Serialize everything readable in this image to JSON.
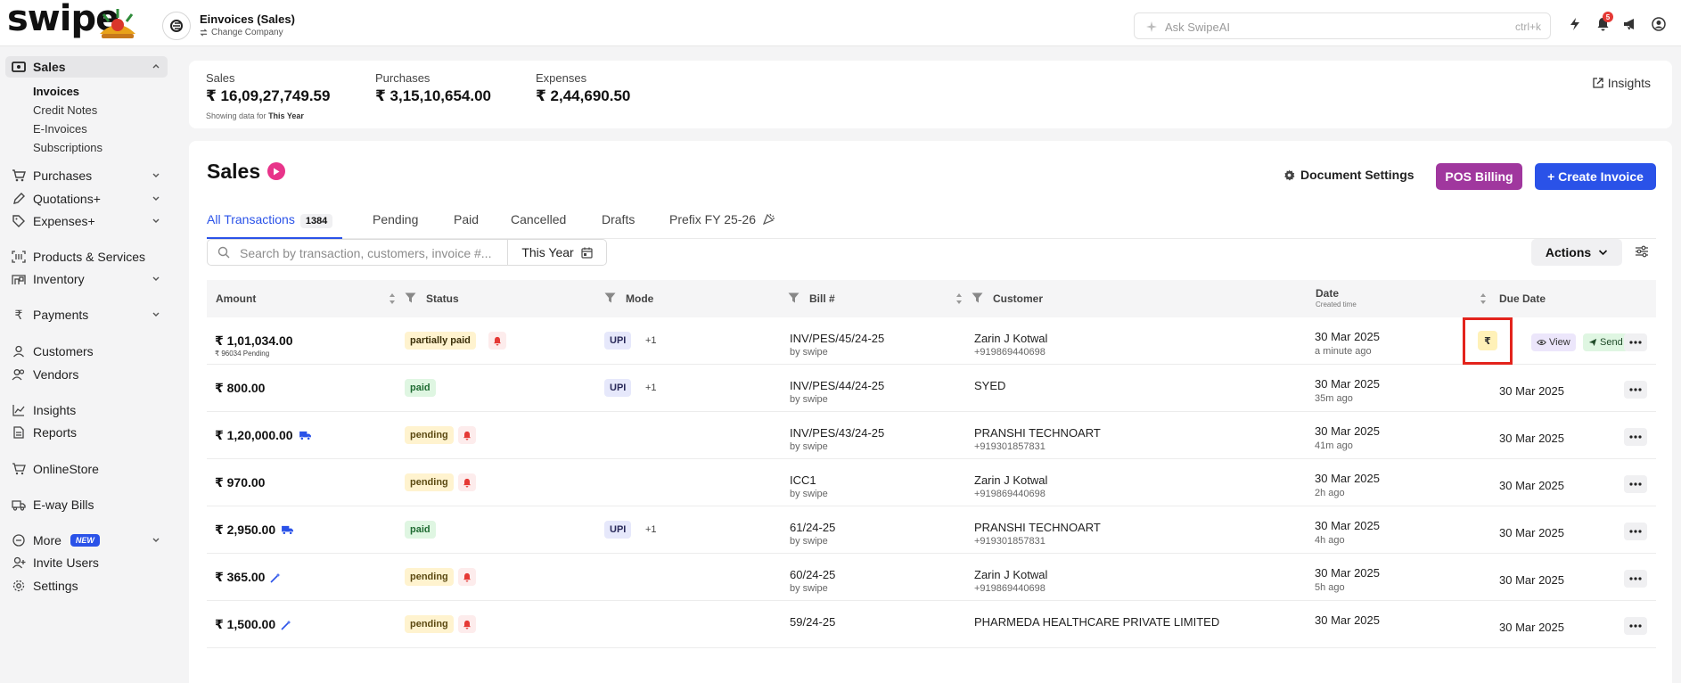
{
  "app": {
    "logo_text": "swipe",
    "company_name": "Einvoices (Sales)",
    "change_company": "Change Company",
    "ai_search_placeholder": "Ask SwipeAI",
    "ai_shortcut": "ctrl+k",
    "notification_count": "5"
  },
  "sidebar": {
    "sales": "Sales",
    "sales_sub": [
      "Invoices",
      "Credit Notes",
      "E-Invoices",
      "Subscriptions"
    ],
    "purchases": "Purchases",
    "quotations": "Quotations+",
    "expenses": "Expenses+",
    "products": "Products & Services",
    "inventory": "Inventory",
    "payments": "Payments",
    "customers": "Customers",
    "vendors": "Vendors",
    "insights": "Insights",
    "reports": "Reports",
    "onlinestore": "OnlineStore",
    "ewaybills": "E-way Bills",
    "more": "More",
    "new_badge": "NEW",
    "invite": "Invite Users",
    "settings": "Settings"
  },
  "summary": {
    "sales_label": "Sales",
    "sales_value": "₹ 16,09,27,749.59",
    "purchases_label": "Purchases",
    "purchases_value": "₹ 3,15,10,654.00",
    "expenses_label": "Expenses",
    "expenses_value": "₹ 2,44,690.50",
    "showing_prefix": "Showing data for",
    "showing_period": "This Year",
    "insights": "Insights"
  },
  "main": {
    "title": "Sales",
    "document_settings": "Document Settings",
    "pos_billing": "POS Billing",
    "create_invoice": "+ Create Invoice",
    "tabs": {
      "all": "All Transactions",
      "all_count": "1384",
      "pending": "Pending",
      "paid": "Paid",
      "cancelled": "Cancelled",
      "drafts": "Drafts",
      "prefix": "Prefix FY 25-26"
    },
    "search_placeholder": "Search by transaction, customers, invoice #...",
    "year_filter": "This Year",
    "actions": "Actions"
  },
  "table": {
    "headers": {
      "amount": "Amount",
      "status": "Status",
      "mode": "Mode",
      "bill": "Bill #",
      "customer": "Customer",
      "date": "Date",
      "date_sub": "Created time",
      "due": "Due Date"
    },
    "row_actions": {
      "view": "View",
      "send": "Send",
      "rupee": "₹"
    },
    "rows": [
      {
        "amount": "₹ 1,01,034.00",
        "sub": "₹ 96034 Pending",
        "status": "partially paid",
        "mode": "UPI",
        "mode_extra": "+1",
        "bill": "INV/PES/45/24-25",
        "by": "by swipe",
        "customer": "Zarin J Kotwal",
        "phone": "+919869440698",
        "date": "30 Mar 2025",
        "ago": "a minute ago",
        "due": ""
      },
      {
        "amount": "₹ 800.00",
        "sub": "",
        "status": "paid",
        "mode": "UPI",
        "mode_extra": "+1",
        "bill": "INV/PES/44/24-25",
        "by": "by swipe",
        "customer": "SYED",
        "phone": "",
        "date": "30 Mar 2025",
        "ago": "35m ago",
        "due": "30 Mar 2025"
      },
      {
        "amount": "₹ 1,20,000.00",
        "sub": "",
        "status": "pending",
        "mode": "",
        "mode_extra": "",
        "bill": "INV/PES/43/24-25",
        "by": "by swipe",
        "customer": "PRANSHI TECHNOART",
        "phone": "+919301857831",
        "date": "30 Mar 2025",
        "ago": "41m ago",
        "due": "30 Mar 2025"
      },
      {
        "amount": "₹ 970.00",
        "sub": "",
        "status": "pending",
        "mode": "",
        "mode_extra": "",
        "bill": "ICC1",
        "by": "by swipe",
        "customer": "Zarin J Kotwal",
        "phone": "+919869440698",
        "date": "30 Mar 2025",
        "ago": "2h ago",
        "due": "30 Mar 2025"
      },
      {
        "amount": "₹ 2,950.00",
        "sub": "",
        "status": "paid",
        "mode": "UPI",
        "mode_extra": "+1",
        "bill": "61/24-25",
        "by": "by swipe",
        "customer": "PRANSHI TECHNOART",
        "phone": "+919301857831",
        "date": "30 Mar 2025",
        "ago": "4h ago",
        "due": "30 Mar 2025"
      },
      {
        "amount": "₹ 365.00",
        "sub": "",
        "status": "pending",
        "mode": "",
        "mode_extra": "",
        "bill": "60/24-25",
        "by": "by swipe",
        "customer": "Zarin J Kotwal",
        "phone": "+919869440698",
        "date": "30 Mar 2025",
        "ago": "5h ago",
        "due": "30 Mar 2025"
      },
      {
        "amount": "₹ 1,500.00",
        "sub": "",
        "status": "pending",
        "mode": "",
        "mode_extra": "",
        "bill": "59/24-25",
        "by": "",
        "customer": "PHARMEDA HEALTHCARE PRIVATE LIMITED",
        "phone": "",
        "date": "30 Mar 2025",
        "ago": "",
        "due": "30 Mar 2025"
      }
    ]
  }
}
